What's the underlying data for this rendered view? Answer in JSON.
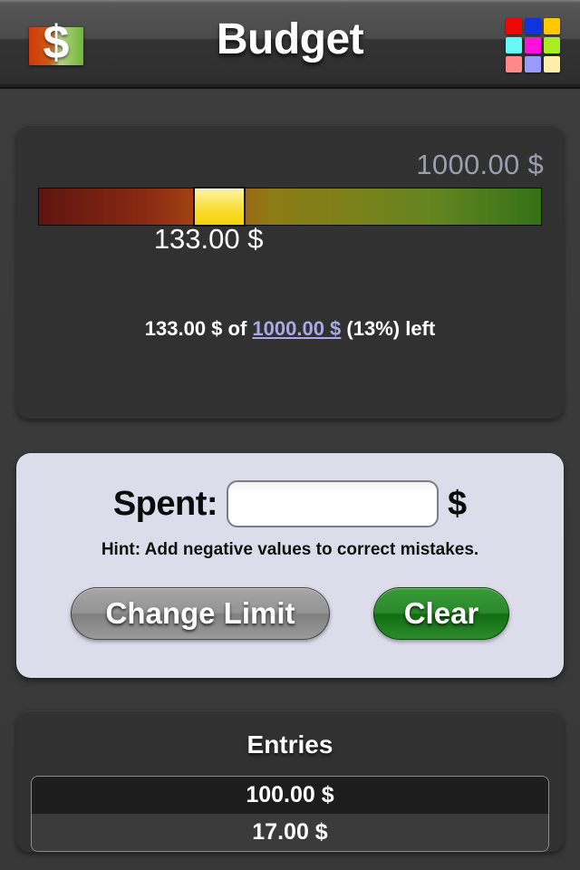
{
  "header": {
    "title": "Budget",
    "logo_icon": "dollar-bill-icon",
    "logo_symbol": "$",
    "grid_icon": "color-palette-grid-icon",
    "grid_colors": [
      "#ee0808",
      "#1133dd",
      "#ffc800",
      "#66f7f7",
      "#ff11dd",
      "#aaee22",
      "#ff8888",
      "#9999ff",
      "#ffeeaa"
    ]
  },
  "budget": {
    "limit_display": "1000.00 $",
    "spent_display": "133.00 $",
    "slider_percent": 36,
    "summary": {
      "amount": "133.00 $",
      "of_word": " of ",
      "limit_link": "1000.00 $",
      "suffix": " (13%) left",
      "percent_left": 13
    }
  },
  "input_panel": {
    "spent_label": "Spent:",
    "spent_value": "",
    "spent_placeholder": "",
    "currency_symbol": "$",
    "hint": "Hint: Add negative values to correct mistakes.",
    "change_limit_label": "Change Limit",
    "clear_label": "Clear"
  },
  "entries": {
    "title": "Entries",
    "rows": [
      "100.00 $",
      "17.00 $"
    ]
  }
}
